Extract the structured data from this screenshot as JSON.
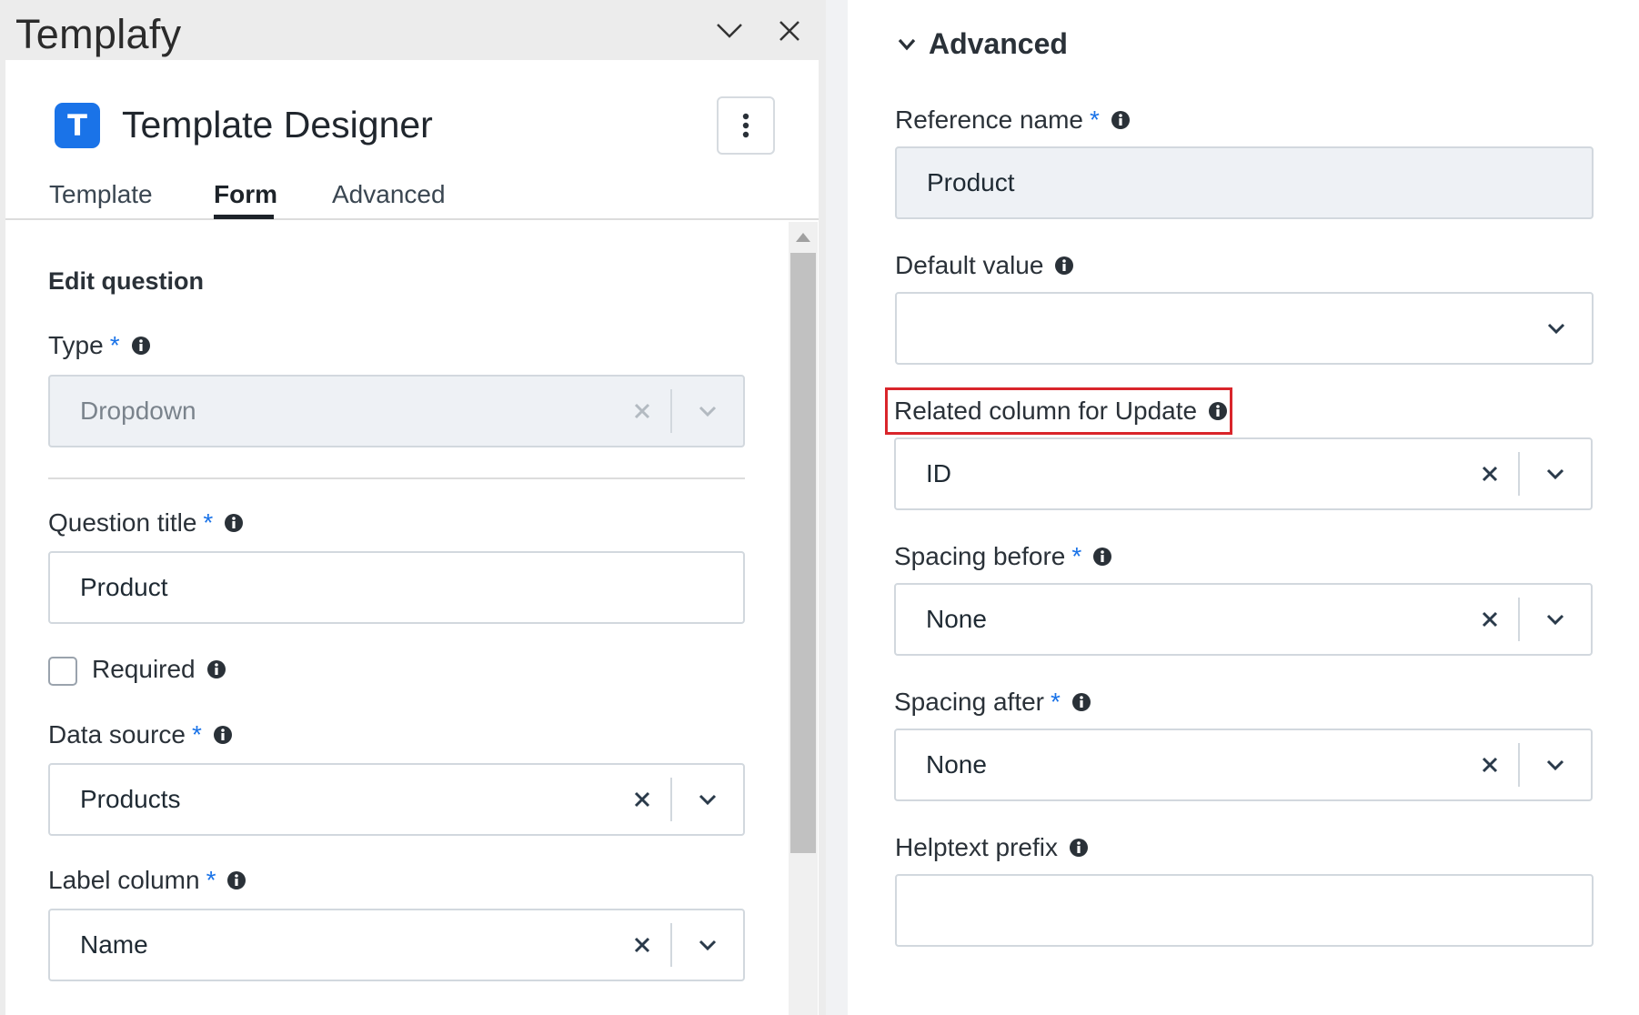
{
  "app": {
    "name": "Templafy"
  },
  "designer": {
    "title": "Template Designer",
    "logo_letter": "T",
    "tabs": [
      {
        "label": "Template"
      },
      {
        "label": "Form",
        "active": true
      },
      {
        "label": "Advanced"
      }
    ]
  },
  "form": {
    "section_title": "Edit question",
    "type": {
      "label": "Type",
      "required_mark": "*",
      "value": "Dropdown"
    },
    "question_title": {
      "label": "Question title",
      "required_mark": "*",
      "value": "Product"
    },
    "required_checkbox": {
      "label": "Required",
      "checked": false
    },
    "data_source": {
      "label": "Data source",
      "required_mark": "*",
      "value": "Products"
    },
    "label_column": {
      "label": "Label column",
      "required_mark": "*",
      "value": "Name"
    }
  },
  "advanced": {
    "section_title": "Advanced",
    "reference_name": {
      "label": "Reference name",
      "required_mark": "*",
      "value": "Product"
    },
    "default_value": {
      "label": "Default value",
      "value": ""
    },
    "related_column": {
      "label": "Related column for Update",
      "value": "ID"
    },
    "spacing_before": {
      "label": "Spacing before",
      "required_mark": "*",
      "value": "None"
    },
    "spacing_after": {
      "label": "Spacing after",
      "required_mark": "*",
      "value": "None"
    },
    "helptext_prefix": {
      "label": "Helptext prefix",
      "value": ""
    }
  },
  "colors": {
    "accent": "#1a73e8",
    "highlight": "#d9252b",
    "field_border": "#d2d8de",
    "field_grey_bg": "#eef1f5"
  },
  "icons": {
    "titlebar": [
      "chevron-down-icon",
      "close-icon"
    ],
    "fields": [
      "info-icon",
      "clear-icon",
      "chevron-down-icon"
    ],
    "menu": "more-vertical-icon"
  }
}
